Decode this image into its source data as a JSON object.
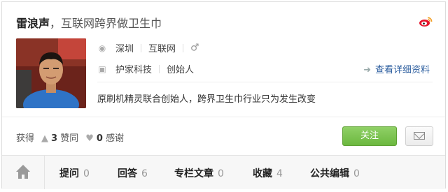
{
  "header": {
    "name": "雷浪声",
    "separator": "，",
    "bio": "互联网跨界做卫生巾",
    "weibo_icon": "weibo-icon"
  },
  "profile": {
    "location": "深圳",
    "industry": "互联网",
    "gender_icon": "male-icon",
    "company": "护家科技",
    "position": "创始人",
    "detail_link": "查看详细资料",
    "description": "原刷机精灵联合创始人，跨界卫生巾行业只为发生改变"
  },
  "stats": {
    "prefix": "获得",
    "likes_count": "3",
    "likes_label": "赞同",
    "thanks_count": "0",
    "thanks_label": "感谢"
  },
  "actions": {
    "follow_label": "关注",
    "message_icon": "mail-icon"
  },
  "tabs": [
    {
      "label": "提问",
      "count": "0"
    },
    {
      "label": "回答",
      "count": "6"
    },
    {
      "label": "专栏文章",
      "count": "0"
    },
    {
      "label": "收藏",
      "count": "4"
    },
    {
      "label": "公共编辑",
      "count": "0"
    }
  ],
  "colors": {
    "follow_button": "#6cb83f",
    "link": "#2b5d9e",
    "weibo": "#e6162d"
  }
}
